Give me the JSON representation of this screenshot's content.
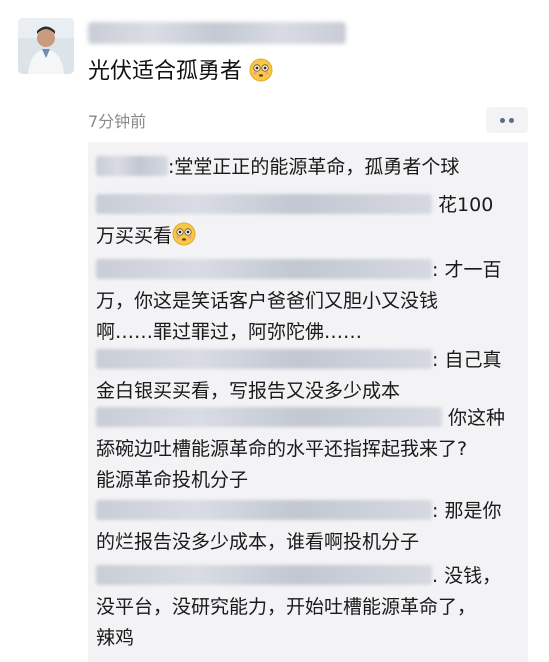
{
  "post": {
    "text": "光伏适合孤勇者",
    "emoji_icon": "flushed-face-emoji",
    "time": "7分钟前"
  },
  "comments": [
    {
      "lines": [
        ":堂堂正正的能源革命，孤勇者个球"
      ]
    },
    {
      "lines": [
        "花100",
        "万买买看"
      ]
    },
    {
      "lines": [
        ": 才一百",
        "万，你这是笑话客户爸爸们又胆小又没钱",
        "啊……罪过罪过，阿弥陀佛……"
      ]
    },
    {
      "lines": [
        ": 自己真",
        "金白银买买看，写报告又没多少成本"
      ]
    },
    {
      "lines": [
        "你这种",
        "舔碗边吐槽能源革命的水平还指挥起我来了?",
        "能源革命投机分子"
      ]
    },
    {
      "lines": [
        ": 那是你",
        "的烂报告没多少成本，谁看啊投机分子"
      ]
    },
    {
      "lines": [
        ". 没钱，",
        "没平台，没研究能力，开始吐槽能源革命了，",
        "辣鸡"
      ]
    }
  ]
}
